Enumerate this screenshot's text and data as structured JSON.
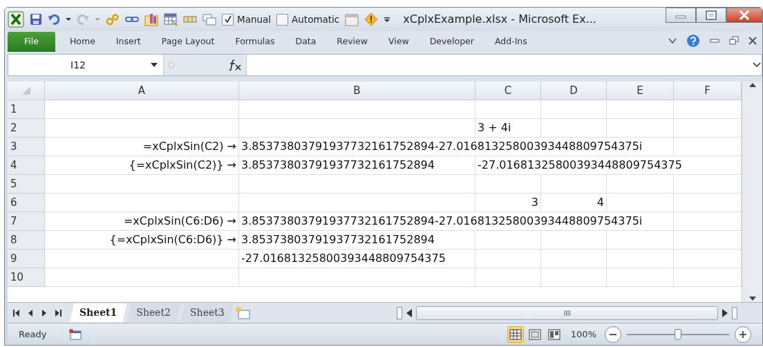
{
  "window": {
    "title": "xCplxExample.xlsx  -  Microsoft Ex..."
  },
  "calc_options": [
    {
      "label": "Manual",
      "checked": true
    },
    {
      "label": "Automatic",
      "checked": false
    }
  ],
  "ribbon_tabs": [
    {
      "label": "File",
      "kind": "file"
    },
    {
      "label": "Home",
      "kind": "tab"
    },
    {
      "label": "Insert",
      "kind": "tab"
    },
    {
      "label": "Page Layout",
      "kind": "tab"
    },
    {
      "label": "Formulas",
      "kind": "tab"
    },
    {
      "label": "Data",
      "kind": "tab"
    },
    {
      "label": "Review",
      "kind": "tab"
    },
    {
      "label": "View",
      "kind": "tab"
    },
    {
      "label": "Developer",
      "kind": "tab"
    },
    {
      "label": "Add-Ins",
      "kind": "tab"
    }
  ],
  "name_box": "I12",
  "columns": [
    "A",
    "B",
    "C",
    "D",
    "E",
    "F"
  ],
  "rows": [
    {
      "header": "1",
      "cells": {}
    },
    {
      "header": "2",
      "cells": {
        "C": {
          "text": "3 + 4i",
          "kind": "text"
        }
      }
    },
    {
      "header": "3",
      "cells": {
        "A": {
          "text": "=xCplxSin(C2)  →",
          "kind": "label"
        },
        "B": {
          "text": "3.85373803791937732161752894-27.01681325800393448809754375i",
          "kind": "text"
        }
      }
    },
    {
      "header": "4",
      "cells": {
        "A": {
          "text": "{=xCplxSin(C2)}  →",
          "kind": "label"
        },
        "B": {
          "text": "3.85373803791937732161752894",
          "kind": "text"
        },
        "C": {
          "text": "-27.01681325800393448809754375",
          "kind": "text"
        }
      }
    },
    {
      "header": "5",
      "cells": {}
    },
    {
      "header": "6",
      "cells": {
        "C": {
          "text": "3",
          "kind": "number"
        },
        "D": {
          "text": "4",
          "kind": "number"
        }
      }
    },
    {
      "header": "7",
      "cells": {
        "A": {
          "text": "=xCplxSin(C6:D6)  →",
          "kind": "label"
        },
        "B": {
          "text": "3.85373803791937732161752894-27.01681325800393448809754375i",
          "kind": "text"
        }
      }
    },
    {
      "header": "8",
      "cells": {
        "A": {
          "text": "{=xCplxSin(C6:D6)}  →",
          "kind": "label"
        },
        "B": {
          "text": "3.85373803791937732161752894",
          "kind": "text"
        }
      }
    },
    {
      "header": "9",
      "cells": {
        "B": {
          "text": "-27.01681325800393448809754375",
          "kind": "text"
        }
      }
    },
    {
      "header": "10",
      "cells": {}
    }
  ],
  "sheet_tabs": [
    {
      "label": "Sheet1",
      "selected": true
    },
    {
      "label": "Sheet2",
      "selected": false
    },
    {
      "label": "Sheet3",
      "selected": false
    }
  ],
  "status": "Ready",
  "view_buttons": [
    {
      "kind": "normal",
      "selected": true
    },
    {
      "kind": "page-layout",
      "selected": false
    },
    {
      "kind": "page-break",
      "selected": false
    }
  ],
  "zoom": {
    "reading": "100%",
    "level": 0.5
  }
}
